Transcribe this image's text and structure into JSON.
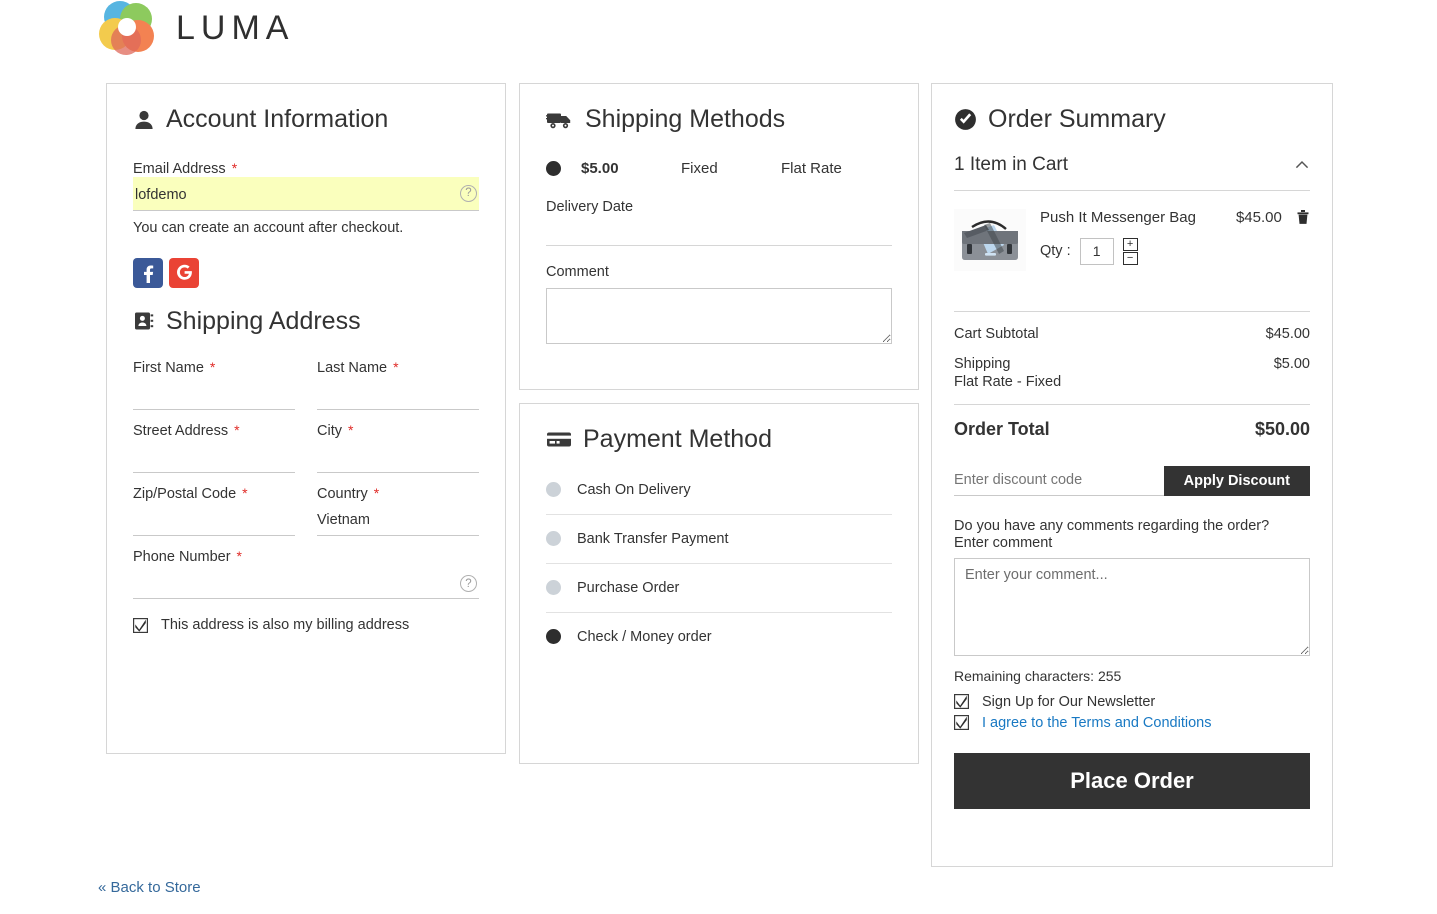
{
  "brand": {
    "name": "LUMA",
    "logo_icon": "luma-rings-logo"
  },
  "account": {
    "title": "Account Information",
    "title_icon": "user-icon",
    "email_label": "Email Address",
    "email_value": "lofdemo",
    "email_tooltip_icon": "question-mark-icon",
    "required_mark": "*",
    "hint": "You can create an account after checkout.",
    "social": [
      {
        "name": "facebook-login-button",
        "glyph": "f",
        "color": "#3b5998"
      },
      {
        "name": "google-login-button",
        "glyph": "G",
        "color": "#ea4335"
      }
    ]
  },
  "shipping_address": {
    "title": "Shipping Address",
    "title_icon": "address-book-icon",
    "fields": [
      {
        "label": "First Name",
        "value": "",
        "required": true
      },
      {
        "label": "Last Name",
        "value": "",
        "required": true
      },
      {
        "label": "Street Address",
        "value": "",
        "required": true
      },
      {
        "label": "City",
        "value": "",
        "required": true
      },
      {
        "label": "Zip/Postal Code",
        "value": "",
        "required": true
      },
      {
        "label": "Country",
        "value": "Vietnam",
        "required": true
      },
      {
        "label": "Phone Number",
        "value": "",
        "required": true
      }
    ],
    "phone_tooltip_icon": "question-mark-icon",
    "billing_checkbox_label": "This address is also my billing address",
    "billing_checkbox_checked": true
  },
  "shipping_methods": {
    "title": "Shipping Methods",
    "title_icon": "delivery-truck-icon",
    "rows": [
      {
        "selected": true,
        "price": "$5.00",
        "method": "Fixed",
        "carrier": "Flat Rate"
      }
    ],
    "delivery_date_label": "Delivery Date",
    "delivery_date_value": "",
    "comment_label": "Comment",
    "comment_value": ""
  },
  "payment_method": {
    "title": "Payment Method",
    "title_icon": "credit-card-icon",
    "options": [
      {
        "label": "Cash On Delivery",
        "selected": false
      },
      {
        "label": "Bank Transfer Payment",
        "selected": false
      },
      {
        "label": "Purchase Order",
        "selected": false
      },
      {
        "label": "Check / Money order",
        "selected": true
      }
    ]
  },
  "order_summary": {
    "title": "Order Summary",
    "title_icon": "check-circle-icon",
    "cart_count_label": "1 Item in Cart",
    "collapse_icon": "chevron-up-icon",
    "item": {
      "thumb_icon": "messenger-bag-image",
      "name": "Push It Messenger Bag",
      "price": "$45.00",
      "remove_icon": "trash-icon",
      "qty_label": "Qty :",
      "qty_value": "1",
      "increase_icon": "plus-icon",
      "decrease_icon": "minus-icon"
    },
    "totals": [
      {
        "label": "Cart Subtotal",
        "value": "$45.00",
        "sub": ""
      },
      {
        "label": "Shipping",
        "value": "$5.00",
        "sub": "Flat Rate - Fixed"
      }
    ],
    "grand_total_label": "Order Total",
    "grand_total_value": "$50.00",
    "discount_placeholder": "Enter discount code",
    "discount_value": "",
    "apply_discount_label": "Apply Discount",
    "comment_question": "Do you have any comments regarding the order?",
    "comment_label": "Enter comment",
    "comment_placeholder": "Enter your comment...",
    "comment_value": "",
    "remaining_characters": "Remaining characters: 255",
    "newsletter_label": "Sign Up for Our Newsletter",
    "newsletter_checked": true,
    "terms_label": "I agree to the Terms and Conditions",
    "terms_checked": true,
    "place_order_label": "Place Order"
  },
  "footer": {
    "back_link": "« Back to Store"
  },
  "colors": {
    "accent_dark": "#333333",
    "link_blue": "#1979c3",
    "required_red": "#e02b27",
    "autofill_yellow": "#faffbd"
  }
}
